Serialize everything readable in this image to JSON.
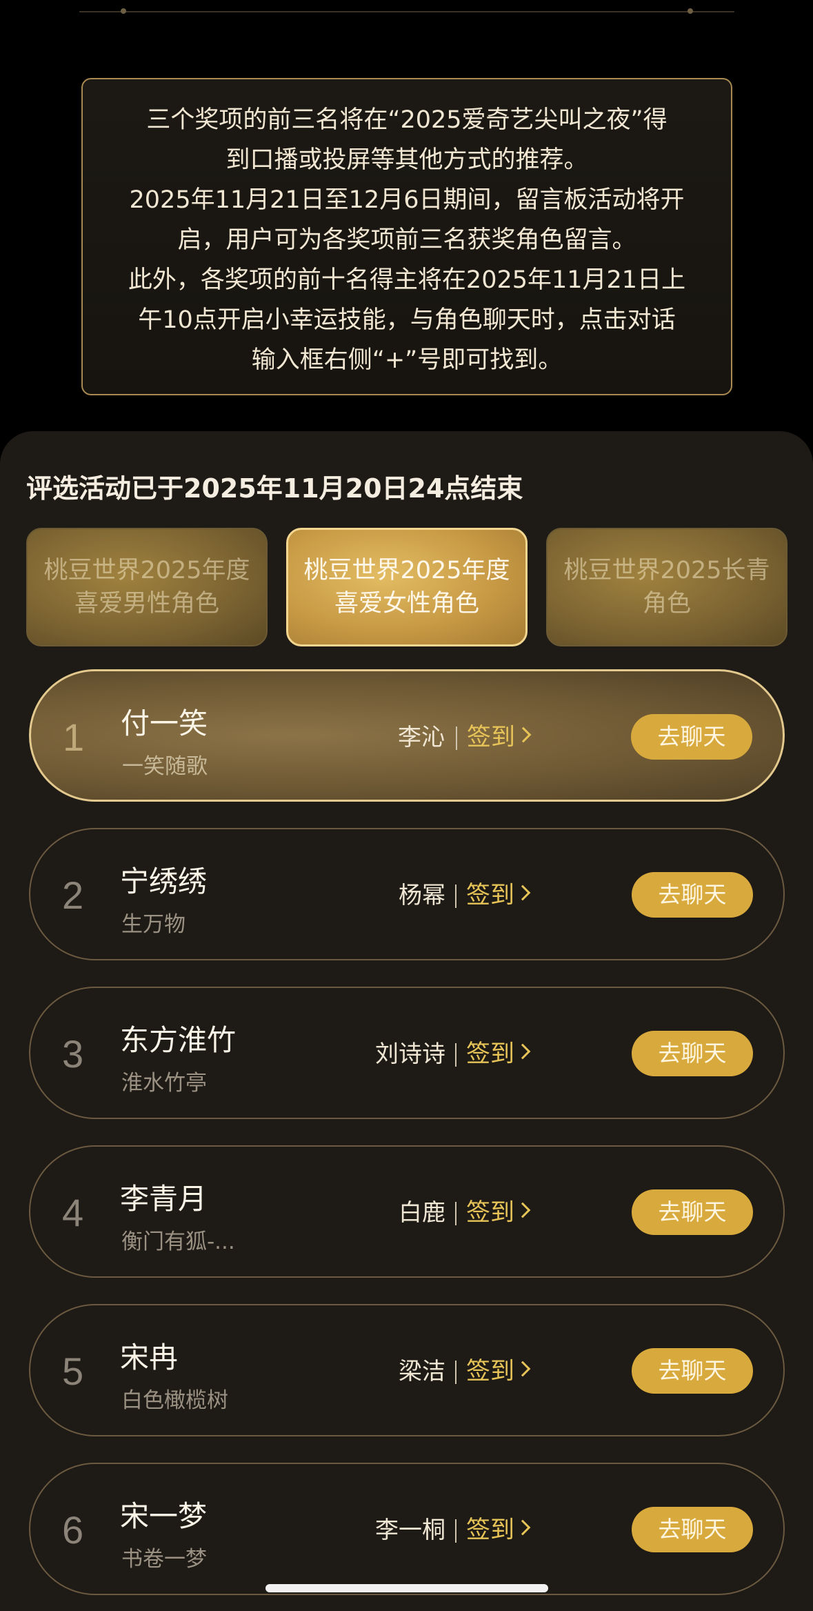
{
  "notice": {
    "lines": [
      "三个奖项的前三名将在“2025爱奇艺尖叫之夜”得",
      "到口播或投屏等其他方式的推荐。",
      "2025年11月21日至12月6日期间，留言板活动将开",
      "启，用户可为各奖项前三名获奖角色留言。",
      "此外，各奖项的前十名得主将在2025年11月21日上",
      "午10点开启小幸运技能，与角色聊天时，点击对话",
      "输入框右侧“+”号即可找到。"
    ]
  },
  "panel": {
    "status": "评选活动已于2025年11月20日24点结束",
    "tabs": [
      {
        "label": "桃豆世界2025年度喜爱男性角色",
        "active": false
      },
      {
        "label": "桃豆世界2025年度喜爱女性角色",
        "active": true
      },
      {
        "label": "桃豆世界2025长青角色",
        "active": false
      }
    ],
    "checkin_label": "签到",
    "chat_label": "去聊天",
    "ranks": [
      {
        "rank": "1",
        "name": "付一笑",
        "sub": "一笑随歌",
        "actor": "李沁"
      },
      {
        "rank": "2",
        "name": "宁绣绣",
        "sub": "生万物",
        "actor": "杨幂"
      },
      {
        "rank": "3",
        "name": "东方淮竹",
        "sub": "淮水竹亭",
        "actor": "刘诗诗"
      },
      {
        "rank": "4",
        "name": "李青月",
        "sub": "衡门有狐-...",
        "actor": "白鹿"
      },
      {
        "rank": "5",
        "name": "宋冉",
        "sub": "白色橄榄树",
        "actor": "梁洁"
      },
      {
        "rank": "6",
        "name": "宋一梦",
        "sub": "书卷一梦",
        "actor": "李一桐"
      }
    ]
  },
  "colors": {
    "accent": "#d8a93c",
    "gold_text": "#e7c458",
    "panel_bg": "#1e1a16"
  }
}
